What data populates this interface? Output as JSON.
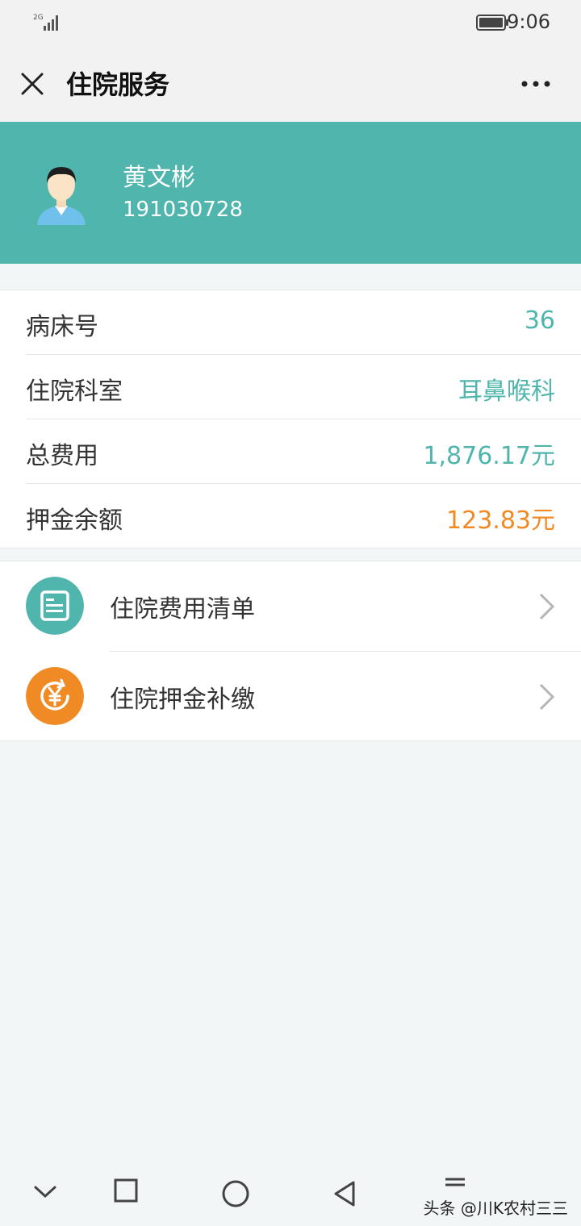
{
  "status_bar": {
    "network": "2G",
    "time": "9:06"
  },
  "nav": {
    "title": "住院服务",
    "close_icon": "close-icon",
    "more_icon": "more-icon"
  },
  "patient": {
    "name": "黄文彬",
    "id": "191030728",
    "avatar_icon": "avatar-icon"
  },
  "info": [
    {
      "label": "病床号",
      "value": "36"
    },
    {
      "label": "住院科室",
      "value": "耳鼻喉科"
    },
    {
      "label": "总费用",
      "value": "1,876.17元"
    },
    {
      "label": "押金余额",
      "value": "123.83元"
    }
  ],
  "menu": [
    {
      "label": "住院费用清单",
      "icon": "bill-list-icon"
    },
    {
      "label": "住院押金补缴",
      "icon": "yuan-payment-icon"
    }
  ],
  "colors": {
    "teal": "#4fb5ad",
    "orange": "#f08a24"
  },
  "watermark": "头条 @川K农村三三"
}
